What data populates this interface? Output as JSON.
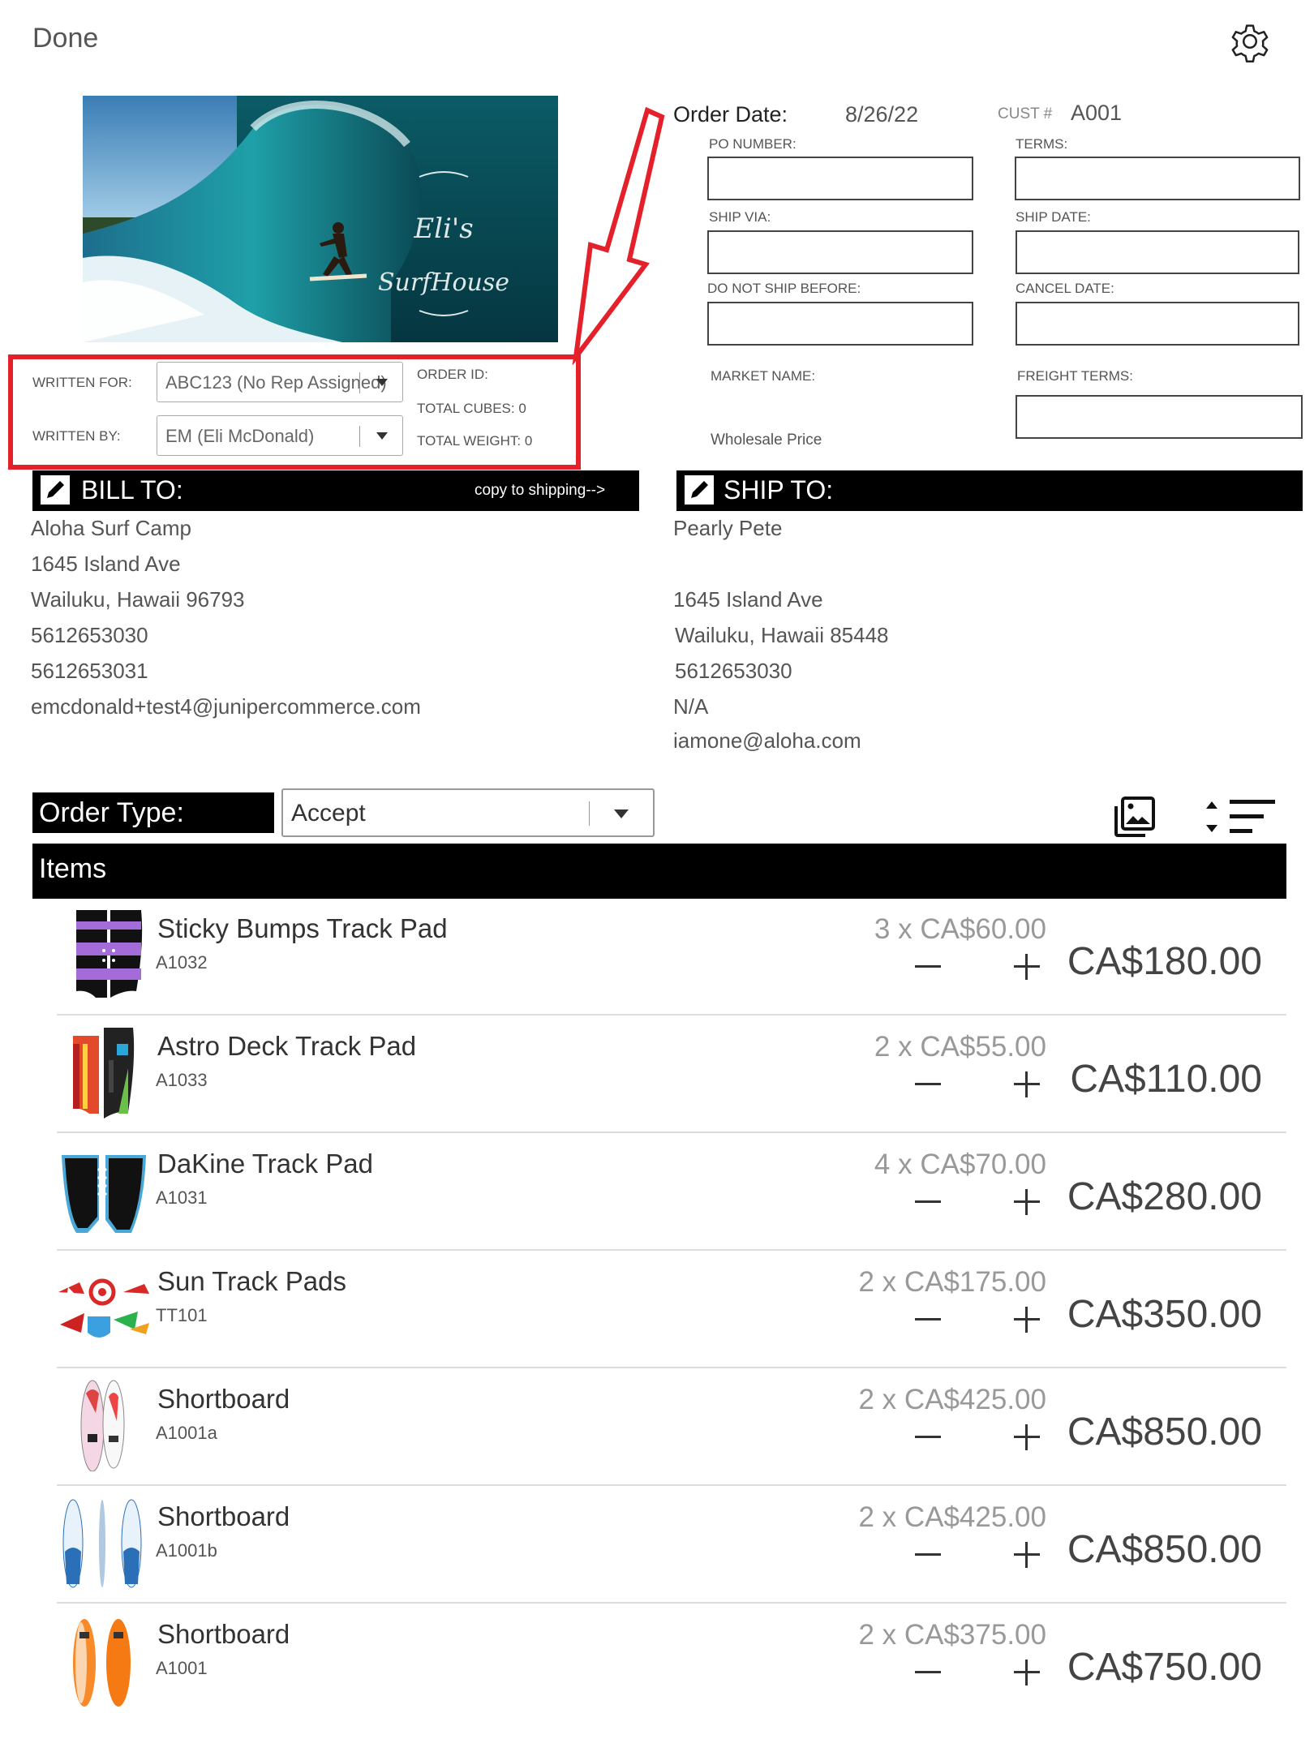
{
  "header": {
    "done_label": "Done",
    "settings_icon": "gear-icon"
  },
  "logo": {
    "line1": "Eli's",
    "line2": "SurfHouse"
  },
  "rep": {
    "written_for_label": "WRITTEN FOR:",
    "written_for_value": "ABC123 (No Rep Assigned)",
    "written_by_label": "WRITTEN BY:",
    "written_by_value": "EM (Eli McDonald)",
    "order_id_label": "ORDER ID:",
    "total_cubes": "TOTAL CUBES: 0",
    "total_weight": "TOTAL WEIGHT: 0"
  },
  "order": {
    "date_label": "Order Date:",
    "date_value": "8/26/22",
    "cust_label": "CUST #",
    "cust_value": "A001",
    "po_label": "PO NUMBER:",
    "terms_label": "TERMS:",
    "ship_via_label": "SHIP VIA:",
    "ship_date_label": "SHIP DATE:",
    "dnsb_label": "DO NOT SHIP BEFORE:",
    "cancel_label": "CANCEL DATE:",
    "market_label": "MARKET NAME:",
    "freight_label": "FREIGHT TERMS:",
    "price_level": "Wholesale Price"
  },
  "bill_to": {
    "title": "BILL TO:",
    "copy_link": "copy to shipping-->",
    "lines": [
      "Aloha Surf Camp",
      "1645 Island Ave",
      "Wailuku, Hawaii  96793",
      "5612653030",
      "5612653031",
      "emcdonald+test4@junipercommerce.com"
    ]
  },
  "ship_to": {
    "title": "SHIP TO:",
    "lines": [
      "Pearly Pete",
      "",
      "1645 Island Ave",
      "Wailuku, Hawaii  85448",
      "5612653030",
      "N/A",
      "iamone@aloha.com"
    ]
  },
  "order_type": {
    "label": "Order Type:",
    "value": "Accept"
  },
  "items_title": "Items",
  "items": [
    {
      "name": "Sticky Bumps Track Pad",
      "sku": "A1032",
      "qty": "3 x CA$60.00",
      "total": "CA$180.00"
    },
    {
      "name": "Astro Deck Track Pad",
      "sku": "A1033",
      "qty": "2 x CA$55.00",
      "total": "CA$110.00"
    },
    {
      "name": "DaKine Track Pad",
      "sku": "A1031",
      "qty": "4 x CA$70.00",
      "total": "CA$280.00"
    },
    {
      "name": "Sun Track Pads",
      "sku": "TT101",
      "qty": "2 x CA$175.00",
      "total": "CA$350.00"
    },
    {
      "name": "Shortboard",
      "sku": "A1001a",
      "qty": "2 x CA$425.00",
      "total": "CA$850.00"
    },
    {
      "name": "Shortboard",
      "sku": "A1001b",
      "qty": "2 x CA$425.00",
      "total": "CA$850.00"
    },
    {
      "name": "Shortboard",
      "sku": "A1001",
      "qty": "2 x CA$375.00",
      "total": "CA$750.00"
    }
  ]
}
